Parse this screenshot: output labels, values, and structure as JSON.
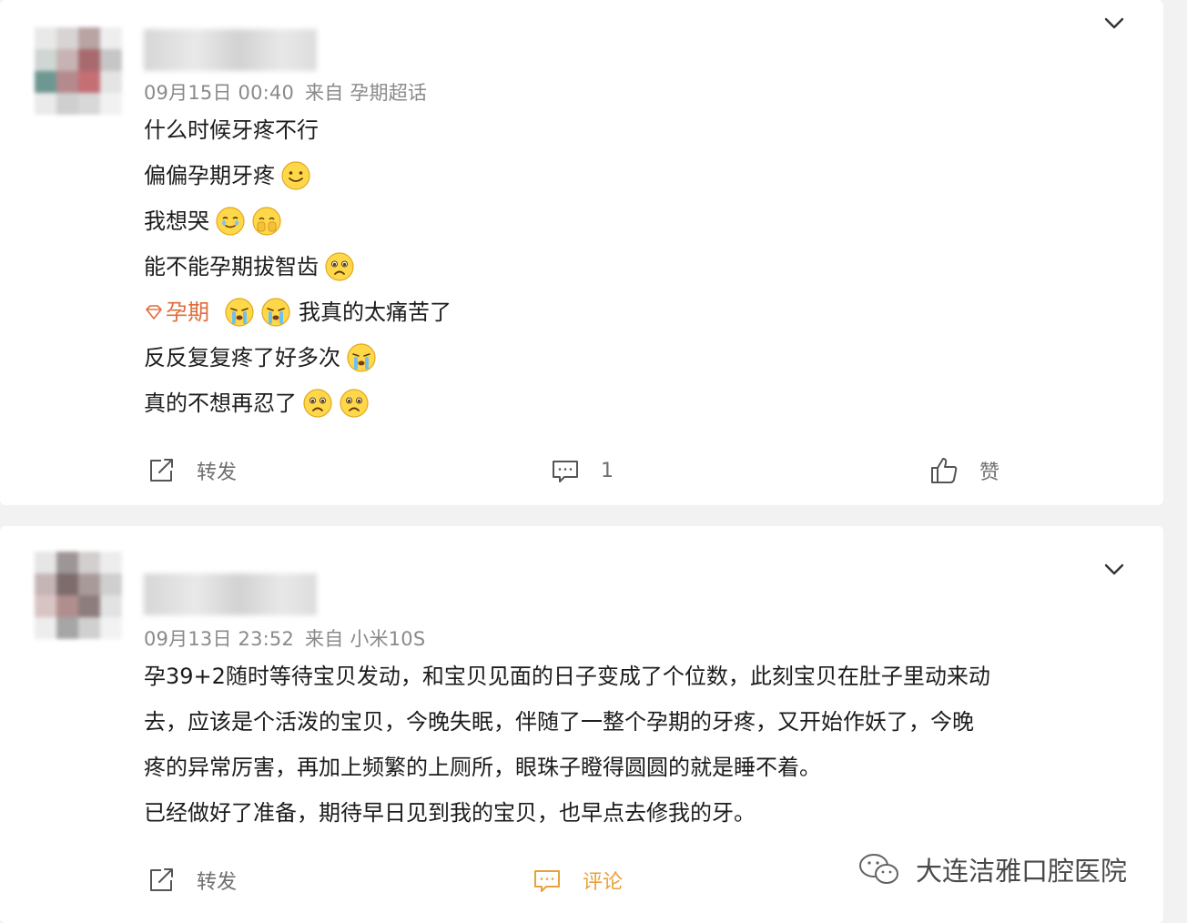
{
  "posts": [
    {
      "meta": {
        "date": "09月15日 00:40",
        "source": "来自 孕期超话"
      },
      "lines": {
        "l1": "什么时候牙疼不行",
        "l2": "偏偏孕期牙疼",
        "l3": "我想哭",
        "l4": "能不能孕期拔智齿",
        "l5_tag": "孕期",
        "l5_text": "我真的太痛苦了",
        "l6": "反反复复疼了好多次",
        "l7": "真的不想再忍了"
      },
      "actions": {
        "forward": "转发",
        "comment_count": "1",
        "like": "赞"
      }
    },
    {
      "meta": {
        "date": "09月13日 23:52",
        "source": "来自 小米10S"
      },
      "paragraph": {
        "p1": "孕39+2随时等待宝贝发动，和宝贝见面的日子变成了个位数，此刻宝贝在肚子里动来动",
        "p2": "去，应该是个活泼的宝贝，今晚失眠，伴随了一整个孕期的牙疼，又开始作妖了，今晚",
        "p3": "疼的异常厉害，再加上频繁的上厕所，眼珠子瞪得圆圆的就是睡不着。",
        "p4": "已经做好了准备，期待早日见到我的宝贝，也早点去修我的牙。"
      },
      "actions": {
        "forward": "转发",
        "comment": "评论"
      }
    }
  ],
  "watermark": {
    "text": "大连洁雅口腔医院"
  },
  "colors": {
    "meta": "#8a8a8a",
    "tag": "#e06c3c",
    "comment_active": "#e8a23a",
    "background": "#f2f2f2"
  },
  "icons": [
    "chevron-down-icon",
    "forward-icon",
    "comment-icon",
    "like-icon",
    "wechat-icon",
    "smile-emoji",
    "cry-emoji",
    "sad-emoji",
    "diamond-tag-icon"
  ]
}
